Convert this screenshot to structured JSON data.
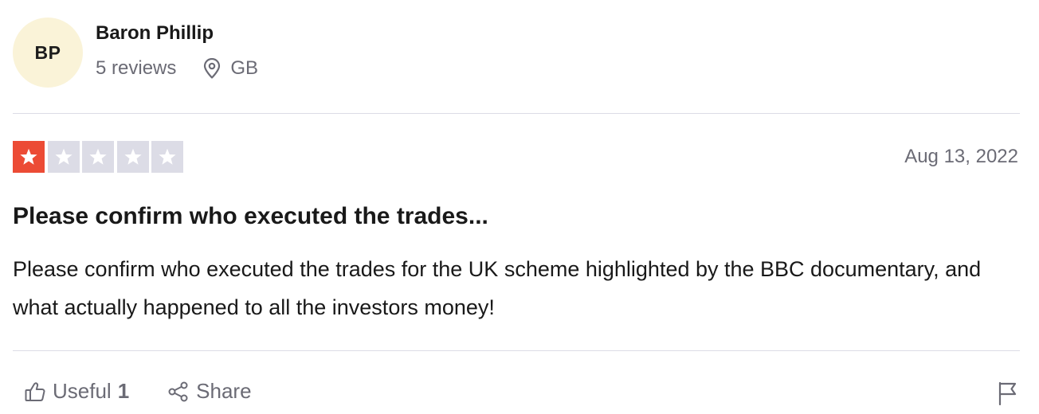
{
  "consumer": {
    "initials": "BP",
    "name": "Baron Phillip",
    "reviews": "5 reviews",
    "country": "GB"
  },
  "review": {
    "rating": 1,
    "rating_max": 5,
    "date": "Aug 13, 2022",
    "title": "Please confirm who executed the trades...",
    "body": "Please confirm who executed the trades for the UK scheme highlighted by the BBC documentary, and what actually happened to all the investors money!"
  },
  "actions": {
    "useful_label": "Useful",
    "useful_count": "1",
    "share_label": "Share"
  },
  "icons": {
    "location": "map-pin-icon",
    "useful": "thumbs-up-icon",
    "share": "share-icon",
    "flag": "flag-icon",
    "star": "star-icon"
  },
  "colors": {
    "avatar_bg": "#faf3d8",
    "star_active": "#ec4b35",
    "star_inactive": "#dcdce6",
    "muted_text": "#6b6b75",
    "divider": "#dcdce6"
  }
}
